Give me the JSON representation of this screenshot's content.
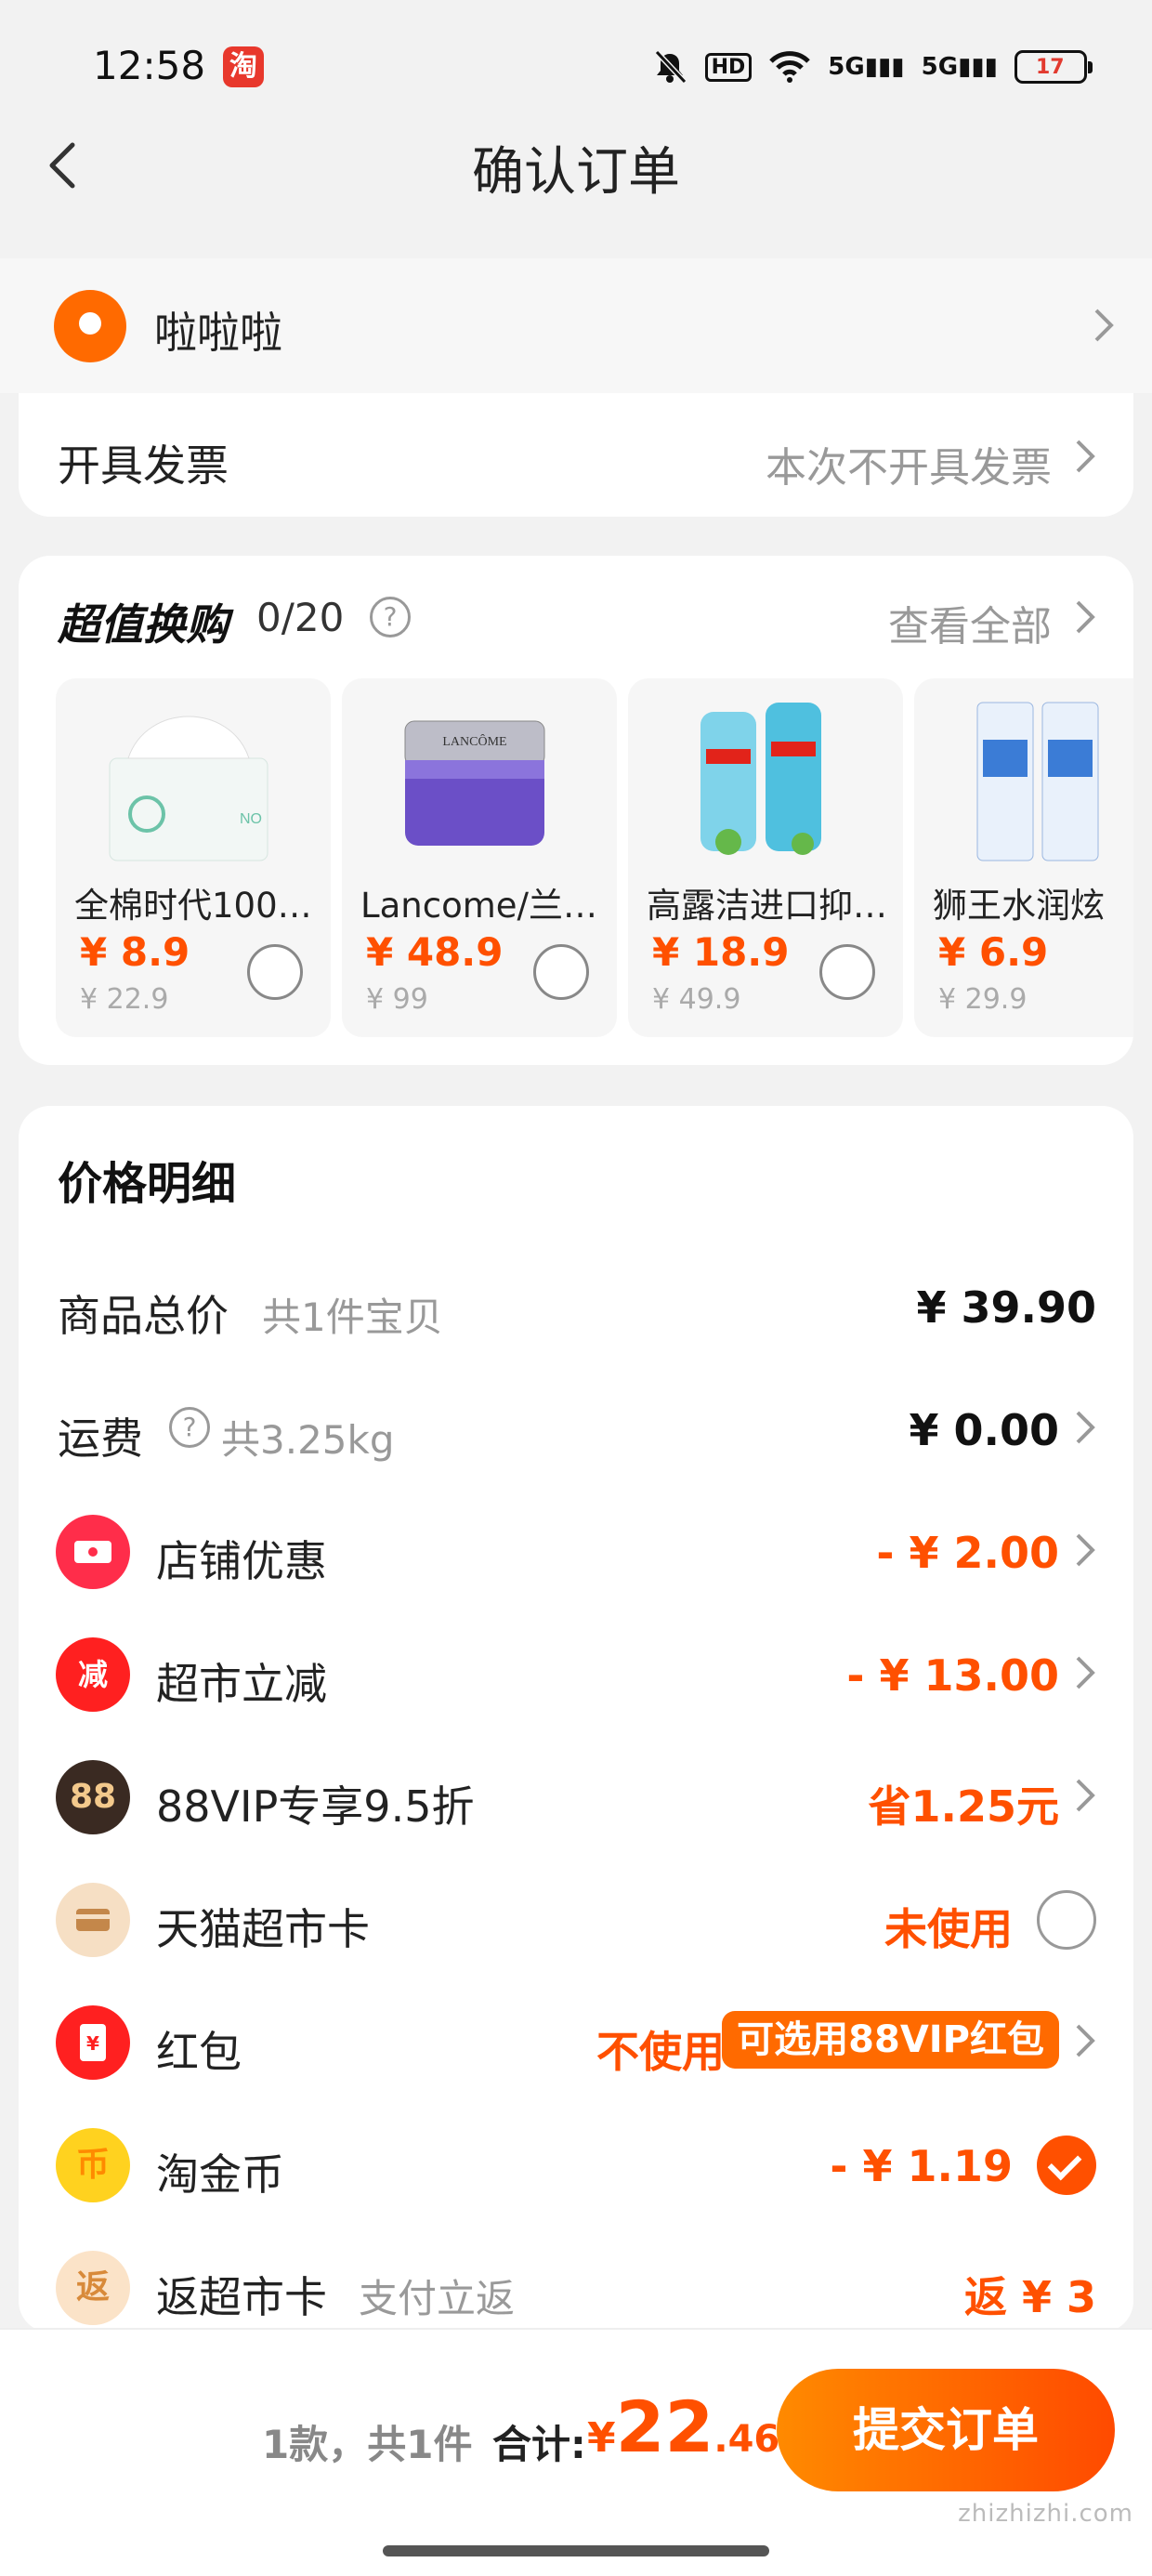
{
  "status": {
    "time": "12:58",
    "taobao_badge": "淘",
    "hd": "HD",
    "net1": "5G",
    "net2": "5G",
    "battery": "17"
  },
  "nav": {
    "title": "确认订单"
  },
  "address": {
    "name": "啦啦啦"
  },
  "invoice": {
    "label": "开具发票",
    "value": "本次不开具发票"
  },
  "deals": {
    "title": "超值换购",
    "count": "0/20",
    "view_all": "查看全部",
    "items": [
      {
        "name": "全棉时代100…",
        "price": "¥ 8.9",
        "orig": "¥ 22.9"
      },
      {
        "name": "Lancome/兰…",
        "price": "¥ 48.9",
        "orig": "¥ 99"
      },
      {
        "name": "高露洁进口抑…",
        "price": "¥ 18.9",
        "orig": "¥ 49.9"
      },
      {
        "name": "狮王水润炫",
        "price": "¥ 6.9",
        "orig": "¥ 29.9"
      }
    ]
  },
  "price_detail": {
    "title": "价格明细",
    "goods_total": {
      "label": "商品总价",
      "sub": "共1件宝贝",
      "value": "¥ 39.90"
    },
    "shipping": {
      "label": "运费",
      "sub": "共3.25kg",
      "value": "¥ 0.00"
    },
    "store_discount": {
      "label": "店铺优惠",
      "value": "- ¥ 2.00",
      "icon": "ticket-icon"
    },
    "market_discount": {
      "label": "超市立减",
      "value": "- ¥ 13.00",
      "icon_text": "减"
    },
    "vip": {
      "label": "88VIP专享9.5折",
      "value": "省1.25元",
      "icon_text": "88"
    },
    "market_card": {
      "label": "天猫超市卡",
      "value": "未使用"
    },
    "red_packet": {
      "label": "红包",
      "value": "不使用",
      "badge": "可选用88VIP红包",
      "icon_text": "¥"
    },
    "coins": {
      "label": "淘金币",
      "value": "- ¥ 1.19",
      "icon_text": "币"
    },
    "rebate": {
      "label": "返超市卡",
      "sub": "支付立返",
      "value": "返 ¥ 3",
      "icon_text": "返"
    }
  },
  "bottom": {
    "count": "1款，共1件",
    "total_label": "合计:",
    "yen": "¥",
    "amount_int": "22",
    "amount_dec": ".46",
    "submit": "提交订单"
  },
  "watermark": "zhizhizhi.com"
}
